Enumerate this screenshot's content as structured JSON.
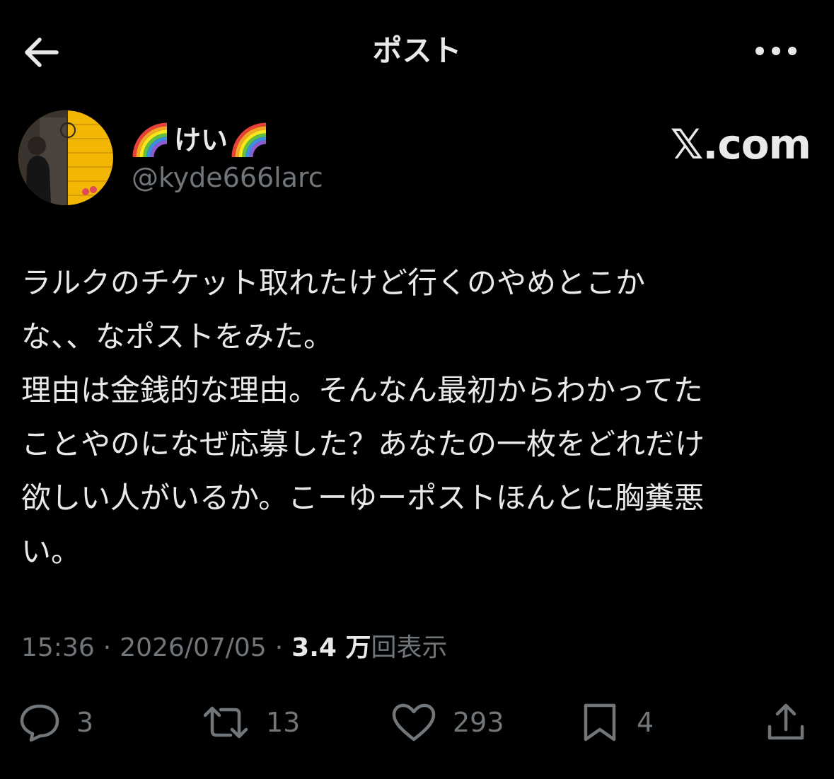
{
  "header": {
    "title": "ポスト",
    "back_icon": "arrow-left-icon",
    "more_icon": "more-horizontal-icon"
  },
  "author": {
    "name_prefix_icon": "rainbow-icon",
    "display_name": "けい",
    "name_suffix_icon": "rainbow-icon",
    "handle": "@kyde666larc"
  },
  "watermark": "𝕏.com",
  "post": {
    "text": "ラルクのチケット取れたけど行くのやめとこか\nな、、なポストをみた。\n理由は金銭的な理由。そんなん最初からわかってた\nことやのになぜ応募した？あなたの一枚をどれだけ\n欲しい人がいるか。こーゆーポストほんとに胸糞悪\nい。"
  },
  "meta": {
    "time": "15:36",
    "separator": "·",
    "date": "2026/07/05",
    "views_count": "3.4 万",
    "views_label": "回表示"
  },
  "actions": {
    "reply": "3",
    "repost": "13",
    "like": "293",
    "bookmark": "4"
  },
  "colors": {
    "background": "#000000",
    "text": "#e7e9ea",
    "secondary": "#71767b"
  }
}
